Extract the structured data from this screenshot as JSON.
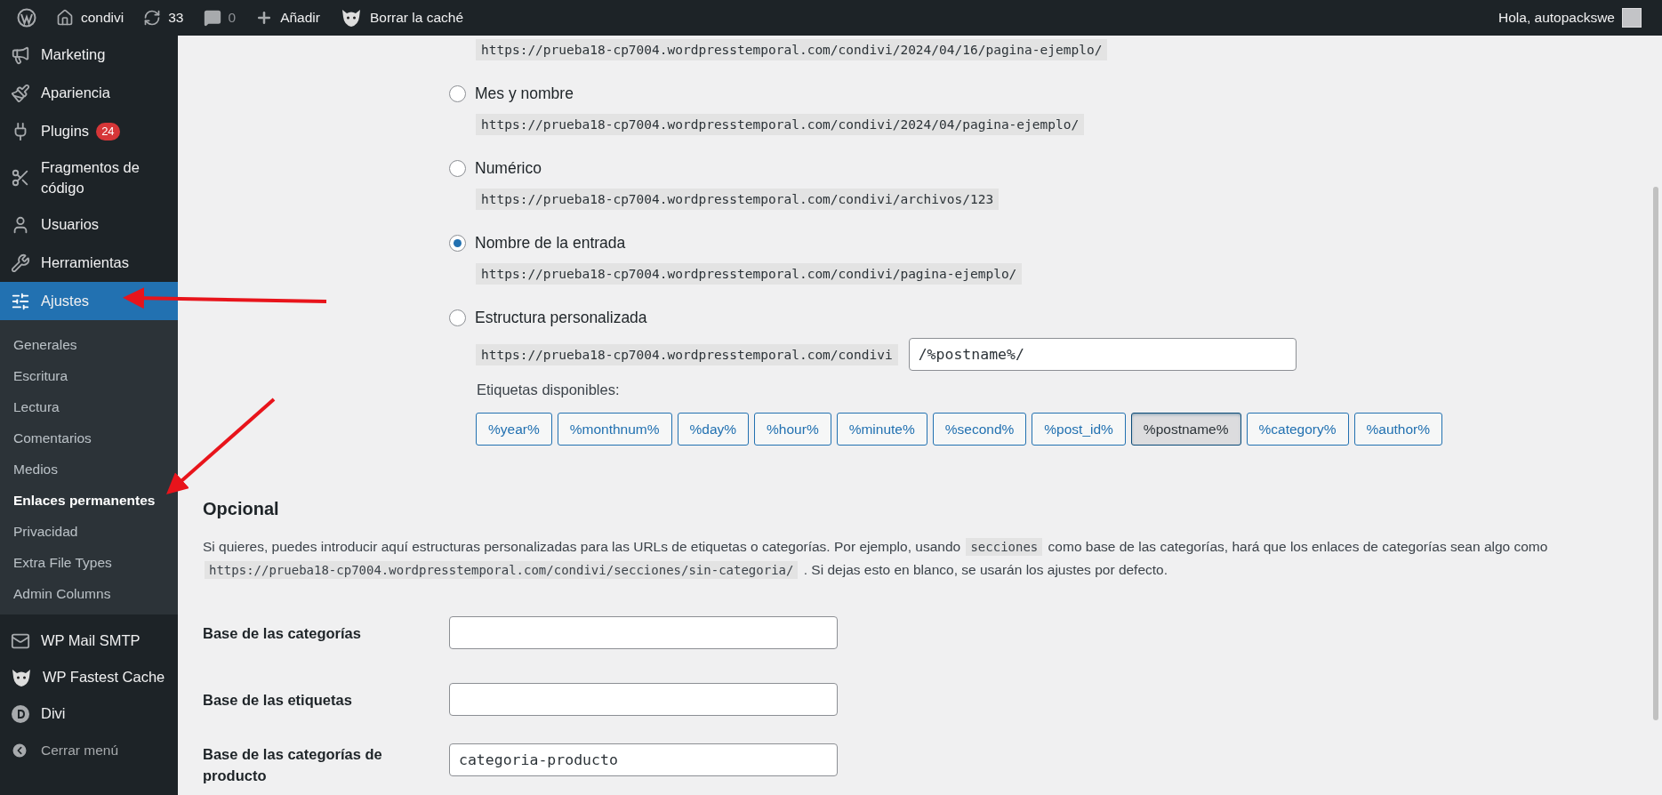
{
  "admin_bar": {
    "site": "condivi",
    "updates": "33",
    "comments": "0",
    "new_label": "Añadir",
    "cache_label": "Borrar la caché",
    "greeting": "Hola, autopackswe"
  },
  "sidebar": {
    "items": [
      {
        "label": "Marketing",
        "selected": false
      },
      {
        "label": "Apariencia",
        "selected": false
      },
      {
        "label": "Plugins",
        "selected": false,
        "badge": "24"
      },
      {
        "label": "Fragmentos de código",
        "selected": false
      },
      {
        "label": "Usuarios",
        "selected": false
      },
      {
        "label": "Herramientas",
        "selected": false
      },
      {
        "label": "Ajustes",
        "selected": true,
        "children": [
          {
            "label": "Generales",
            "selected": false
          },
          {
            "label": "Escritura",
            "selected": false
          },
          {
            "label": "Lectura",
            "selected": false
          },
          {
            "label": "Comentarios",
            "selected": false
          },
          {
            "label": "Medios",
            "selected": false
          },
          {
            "label": "Enlaces permanentes",
            "selected": true
          },
          {
            "label": "Privacidad",
            "selected": false
          },
          {
            "label": "Extra File Types",
            "selected": false
          },
          {
            "label": "Admin Columns",
            "selected": false
          }
        ]
      },
      {
        "label": "WP Mail SMTP",
        "selected": false
      },
      {
        "label": "WP Fastest Cache",
        "selected": false
      },
      {
        "label": "Divi",
        "selected": false
      }
    ],
    "collapse_label": "Cerrar menú"
  },
  "permalinks": {
    "top_url": "https://prueba18-cp7004.wordpresstemporal.com/condivi/2024/04/16/pagina-ejemplo/",
    "options": [
      {
        "kind": "radio",
        "label": "Mes y nombre",
        "url": "https://prueba18-cp7004.wordpresstemporal.com/condivi/2024/04/pagina-ejemplo/",
        "selected": false
      },
      {
        "kind": "radio",
        "label": "Numérico",
        "url": "https://prueba18-cp7004.wordpresstemporal.com/condivi/archivos/123",
        "selected": false
      },
      {
        "kind": "radio",
        "label": "Nombre de la entrada",
        "url": "https://prueba18-cp7004.wordpresstemporal.com/condivi/pagina-ejemplo/",
        "selected": true
      },
      {
        "kind": "custom",
        "label": "Estructura personalizada",
        "url": "https://prueba18-cp7004.wordpresstemporal.com/condivi",
        "value": "/%postname%/",
        "selected": false
      }
    ],
    "tags_label": "Etiquetas disponibles:",
    "tags": [
      {
        "label": "%year%",
        "selected": false
      },
      {
        "label": "%monthnum%",
        "selected": false
      },
      {
        "label": "%day%",
        "selected": false
      },
      {
        "label": "%hour%",
        "selected": false
      },
      {
        "label": "%minute%",
        "selected": false
      },
      {
        "label": "%second%",
        "selected": false
      },
      {
        "label": "%post_id%",
        "selected": false
      },
      {
        "label": "%postname%",
        "selected": true
      },
      {
        "label": "%category%",
        "selected": false
      },
      {
        "label": "%author%",
        "selected": false
      }
    ]
  },
  "optional": {
    "heading": "Opcional",
    "paragraph": [
      {
        "kind": "text",
        "text": "Si quieres, puedes introducir aquí estructuras personalizadas para las URLs de etiquetas o categorías. Por ejemplo, usando "
      },
      {
        "kind": "code",
        "text": "secciones"
      },
      {
        "kind": "text",
        "text": " como base de las categorías, hará que los enlaces de categorías sean algo como "
      },
      {
        "kind": "code",
        "text": "https://prueba18-cp7004.wordpresstemporal.com/condivi/secciones/sin-categoria/"
      },
      {
        "kind": "text",
        "text": " . Si dejas esto en blanco, se usarán los ajustes por defecto."
      }
    ],
    "fields": [
      {
        "label": "Base de las categorías"
      },
      {
        "label": "Base de las etiquetas"
      },
      {
        "label": "Base de las categorías de producto",
        "value": "categoria-producto"
      }
    ]
  }
}
